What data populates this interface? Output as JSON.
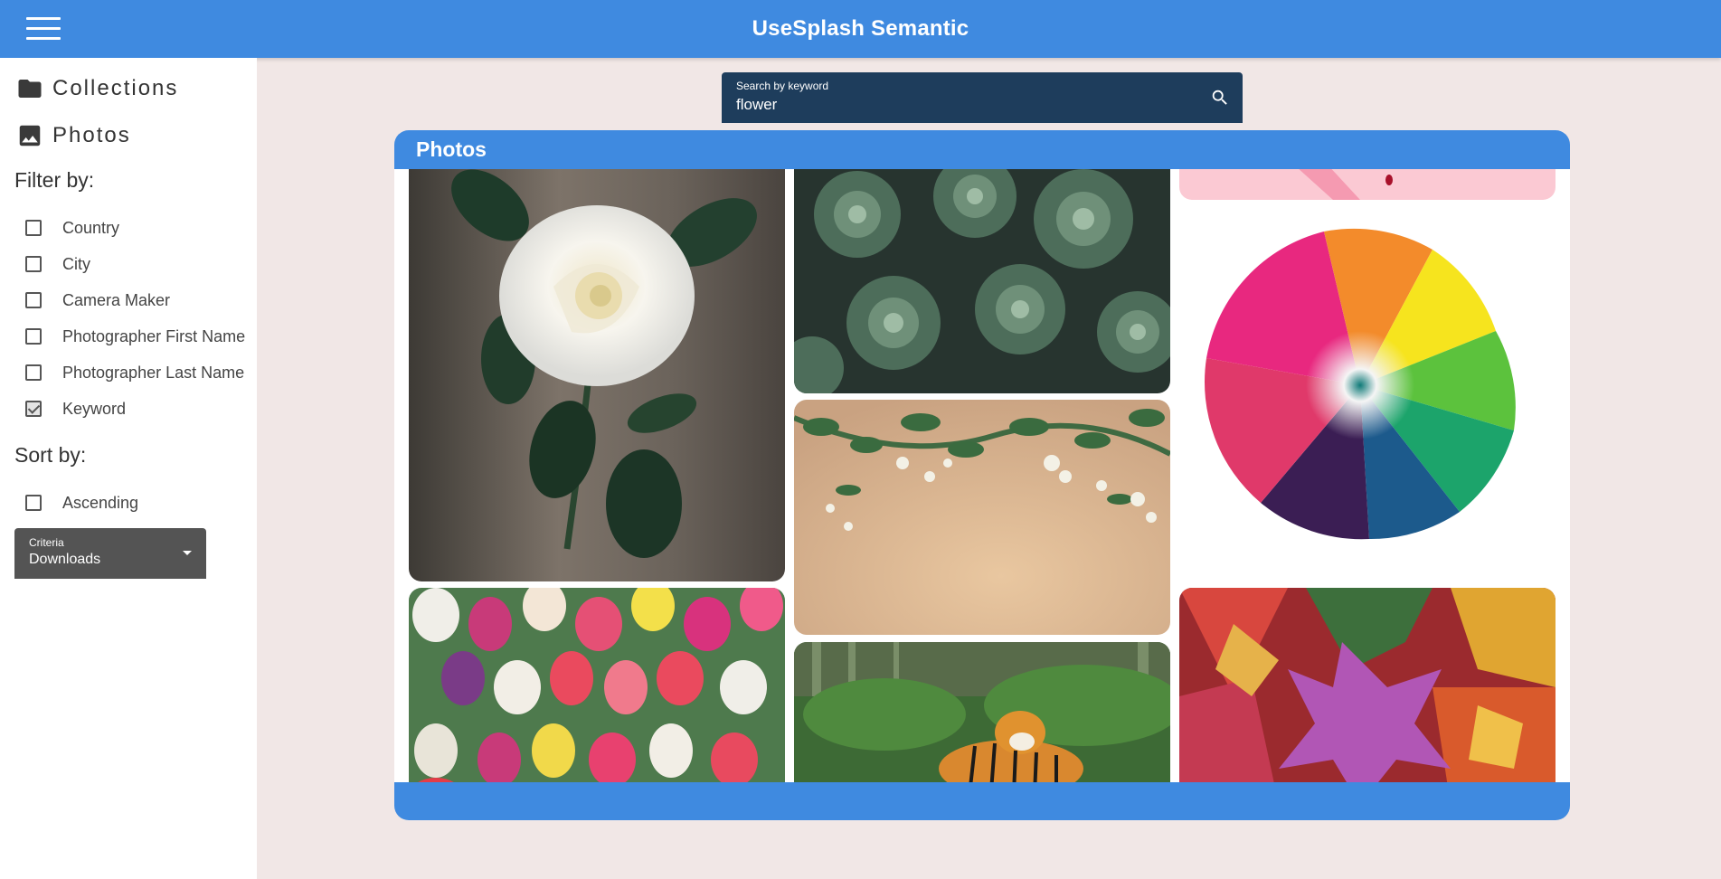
{
  "header": {
    "title": "UseSplash Semantic",
    "menu_icon": "hamburger-menu-icon"
  },
  "sidebar": {
    "nav": [
      {
        "label": "Collections",
        "icon": "folder-icon"
      },
      {
        "label": "Photos",
        "icon": "image-icon"
      }
    ],
    "filter_title": "Filter by:",
    "filters": [
      {
        "label": "Country",
        "checked": false
      },
      {
        "label": "City",
        "checked": false
      },
      {
        "label": "Camera Maker",
        "checked": false
      },
      {
        "label": "Photographer First Name",
        "checked": false
      },
      {
        "label": "Photographer Last Name",
        "checked": false
      },
      {
        "label": "Keyword",
        "checked": true
      }
    ],
    "sort_title": "Sort by:",
    "sort_options": [
      {
        "label": "Ascending",
        "checked": false
      }
    ],
    "criteria": {
      "caption": "Criteria",
      "value": "Downloads"
    }
  },
  "search": {
    "caption": "Search by keyword",
    "value": "flower",
    "icon": "search-icon"
  },
  "photos_panel": {
    "title": "Photos",
    "photos": [
      {
        "subject": "white rose"
      },
      {
        "subject": "succulents"
      },
      {
        "subject": "pink photo (partially visible)"
      },
      {
        "subject": "leaves on wooden table"
      },
      {
        "subject": "rainbow chrysanthemum"
      },
      {
        "subject": "tulips bouquet"
      },
      {
        "subject": "tiger on grass"
      },
      {
        "subject": "autumn maple leaves"
      }
    ]
  },
  "colors": {
    "header": "#3f8ae0",
    "search_bg": "#1e3d5c",
    "select_bg": "#545454",
    "page_bg": "#f1e7e6",
    "sidebar_bg": "#ffffff"
  }
}
